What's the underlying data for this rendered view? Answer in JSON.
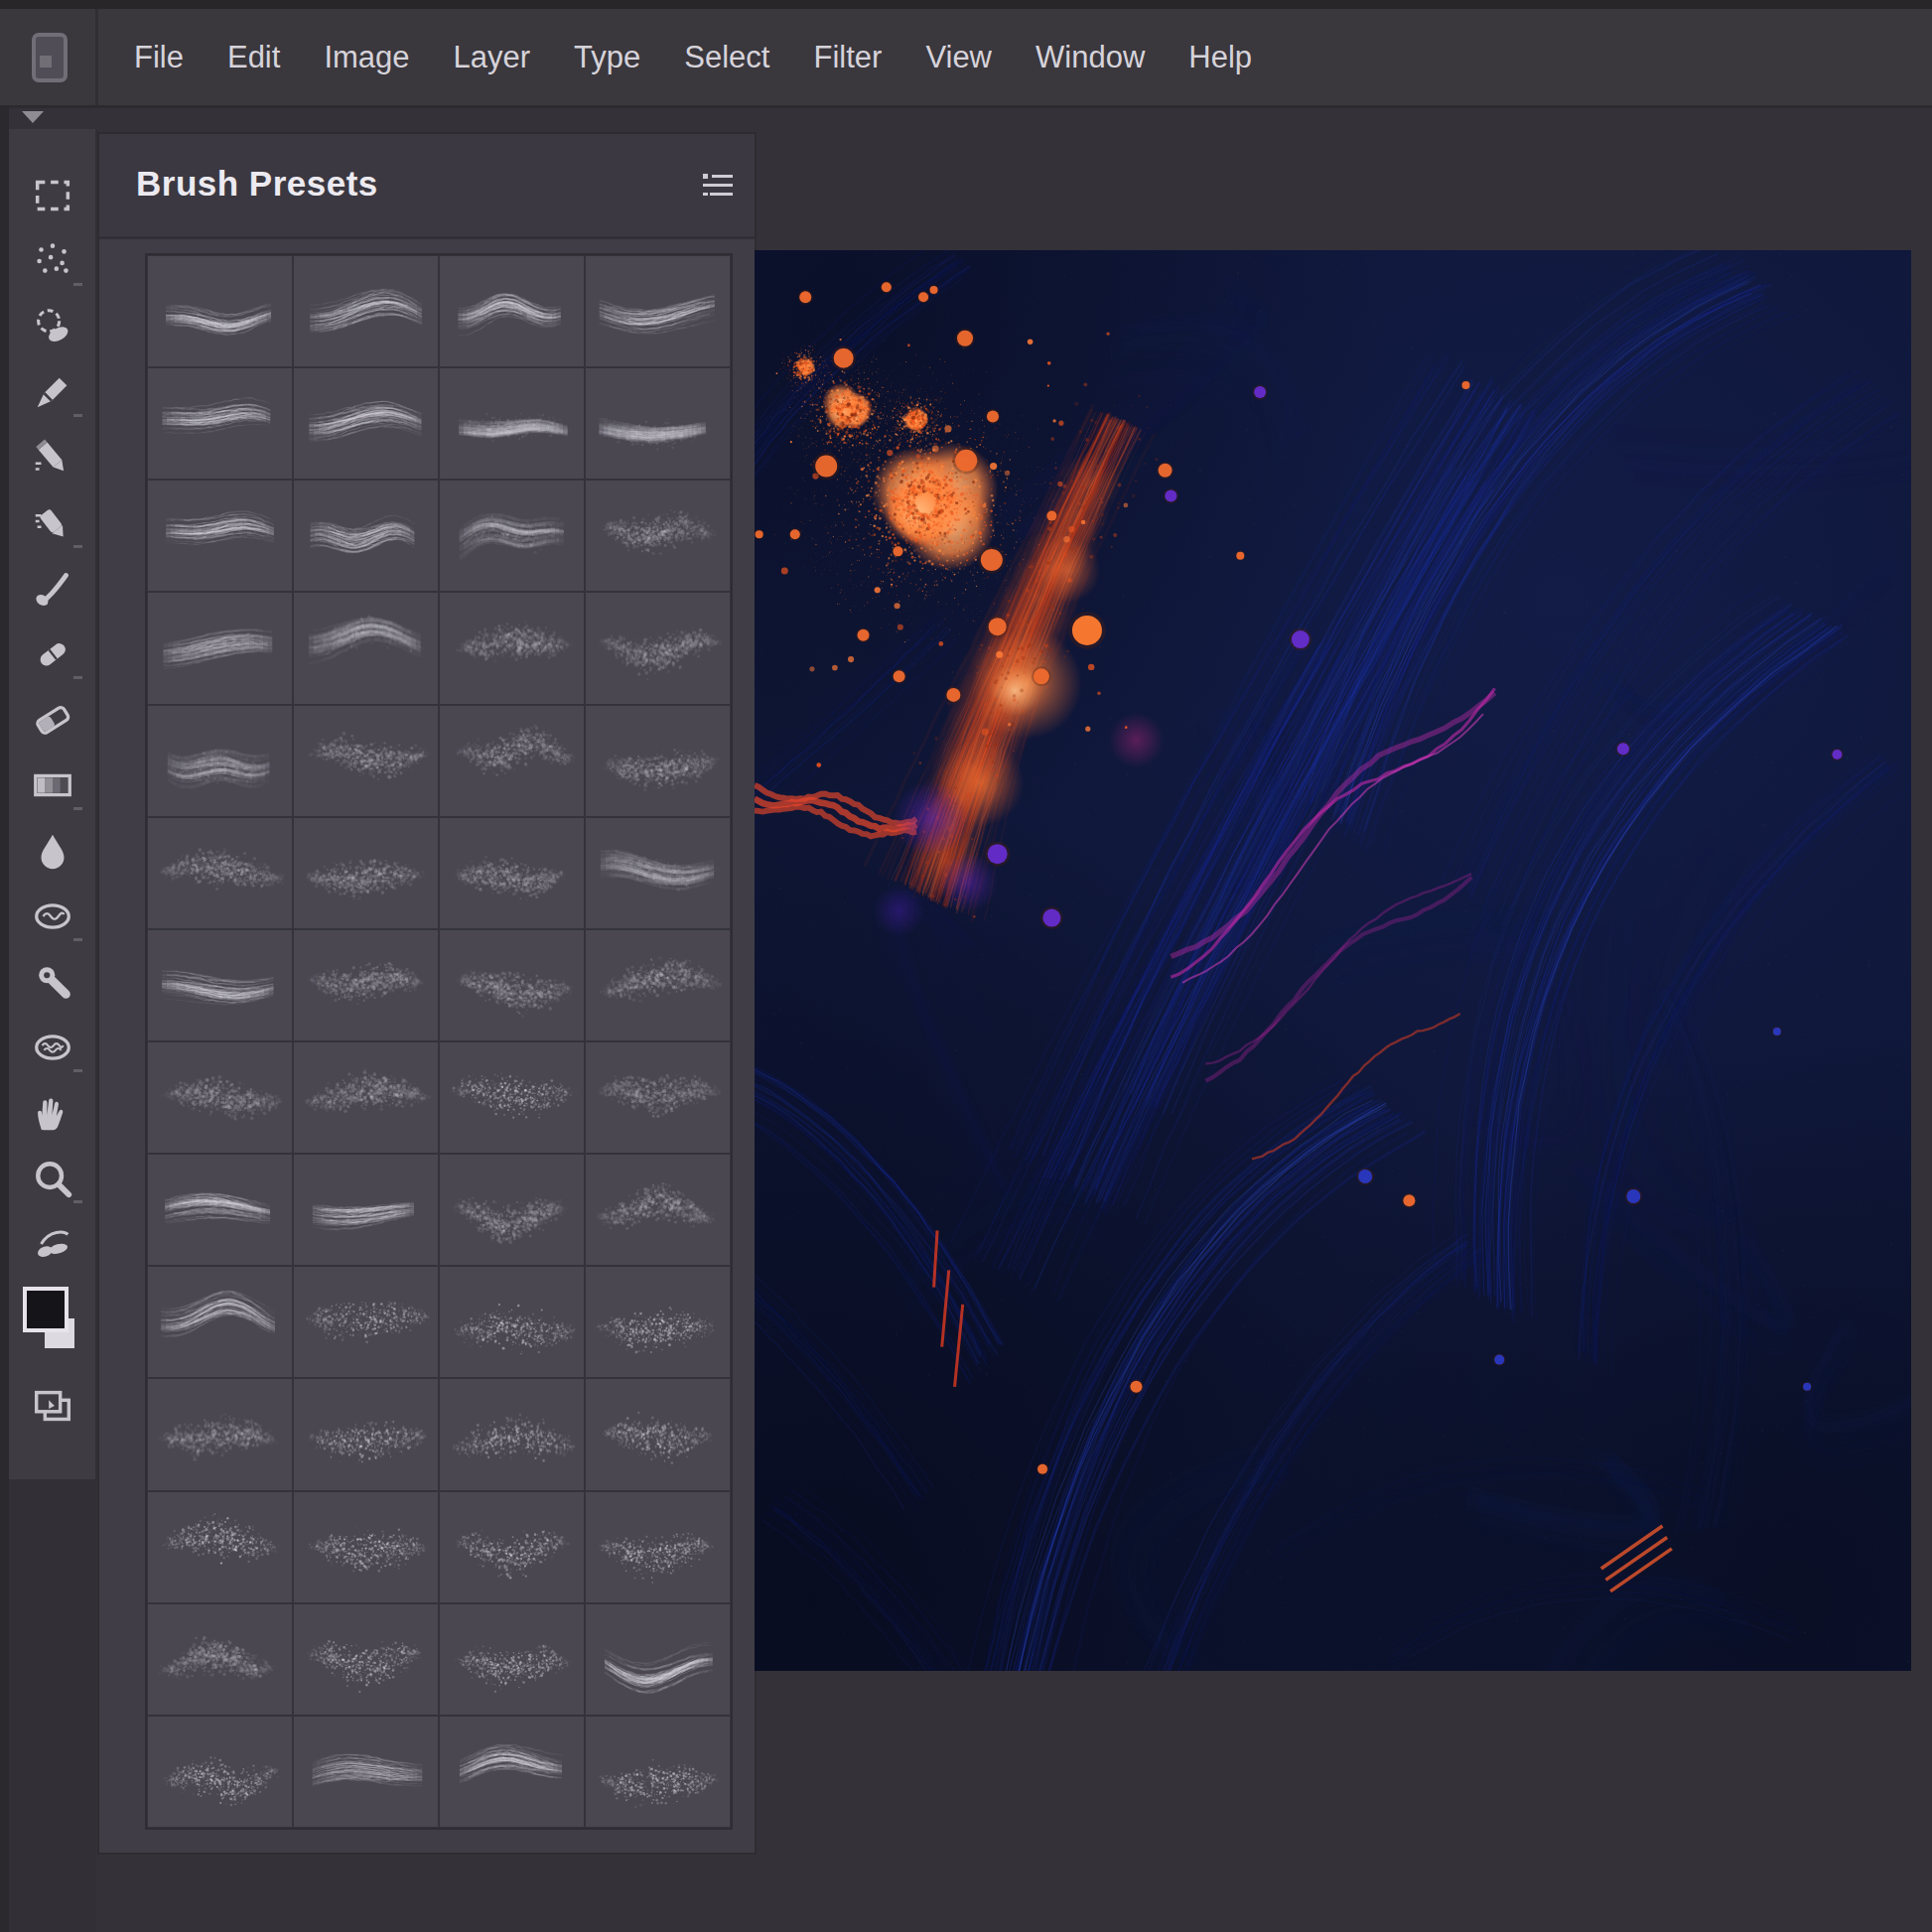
{
  "menu_bar": {
    "items": [
      "File",
      "Edit",
      "Image",
      "Layer",
      "Type",
      "Select",
      "Filter",
      "View",
      "Window",
      "Help"
    ]
  },
  "toolbar": {
    "tools": [
      "marquee",
      "lasso",
      "brush-cluster",
      "pen",
      "pencil",
      "mixer-pen",
      "brush",
      "healing",
      "eraser",
      "gradient",
      "blur",
      "smudge",
      "dodge",
      "sponge",
      "hand",
      "zoom",
      "history-brush"
    ],
    "swatches": {
      "foreground": "#151419",
      "background": "#dcd9e1"
    },
    "extra": [
      "duplicate"
    ]
  },
  "panel": {
    "title": "Brush Presets",
    "menu_icon": "list-menu-icon",
    "grid": {
      "columns": 4,
      "rows": 14,
      "cell_styles": [
        [
          "hair",
          "hair",
          "hair",
          "hair"
        ],
        [
          "hair",
          "hair",
          "soft",
          "soft"
        ],
        [
          "hair",
          "hair",
          "soft",
          "fuzz"
        ],
        [
          "hair",
          "soft",
          "fuzz",
          "fuzz"
        ],
        [
          "soft",
          "fuzz",
          "fuzz",
          "fuzz"
        ],
        [
          "fuzz",
          "fuzz",
          "fuzz",
          "soft"
        ],
        [
          "hair",
          "fuzz",
          "fuzz",
          "fuzz"
        ],
        [
          "fuzz",
          "fuzz",
          "stip",
          "fuzz"
        ],
        [
          "hair",
          "hair",
          "fuzz",
          "fuzz"
        ],
        [
          "hair",
          "stip",
          "stip",
          "stip"
        ],
        [
          "fuzz",
          "stip",
          "stip",
          "stip"
        ],
        [
          "stip",
          "stip",
          "stip",
          "stip"
        ],
        [
          "fuzz",
          "stip",
          "stip",
          "hair"
        ],
        [
          "stip",
          "hair",
          "hair",
          "stip"
        ]
      ]
    }
  },
  "canvas_art": {
    "background": "#0e1534",
    "palette": {
      "blue_deep": "#16219a",
      "blue": "#1e32c0",
      "blue_bright": "#3a5bf0",
      "orange": "#ff7433",
      "orange_deep": "#f04f1e",
      "red": "#e03a20",
      "magenta": "#c22aa8",
      "purple": "#6b2ed8"
    },
    "description": "Abstract digital painting: sweeping blue brush strokes, orange paint splatters and dots, bright red-orange diagonal streak, magenta wavy lines on a dark navy background"
  }
}
